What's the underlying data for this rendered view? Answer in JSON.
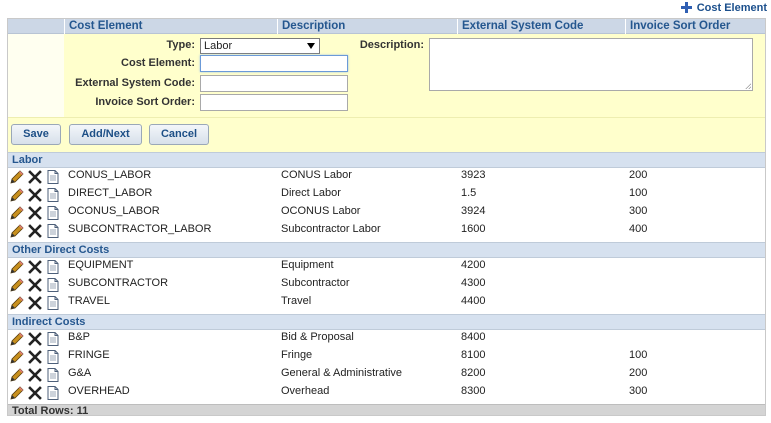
{
  "toolbar": {
    "add_label": "Cost Element",
    "add_icon": "plus-icon"
  },
  "columns": [
    "Cost Element",
    "Description",
    "External System Code",
    "Invoice Sort Order"
  ],
  "form": {
    "type_label": "Type:",
    "type_value": "Labor",
    "cost_element_label": "Cost Element:",
    "cost_element_value": "",
    "external_code_label": "External System Code:",
    "external_code_value": "",
    "sort_order_label": "Invoice Sort Order:",
    "sort_order_value": "",
    "description_label": "Description:",
    "description_value": ""
  },
  "buttons": {
    "save": "Save",
    "add_next": "Add/Next",
    "cancel": "Cancel"
  },
  "groups": [
    {
      "name": "Labor",
      "rows": [
        {
          "element": "CONUS_LABOR",
          "description": "CONUS Labor",
          "code": "3923",
          "sort": "200"
        },
        {
          "element": "DIRECT_LABOR",
          "description": "Direct Labor",
          "code": "1.5",
          "sort": "100"
        },
        {
          "element": "OCONUS_LABOR",
          "description": "OCONUS Labor",
          "code": "3924",
          "sort": "300"
        },
        {
          "element": "SUBCONTRACTOR_LABOR",
          "description": "Subcontractor Labor",
          "code": "1600",
          "sort": "400"
        }
      ]
    },
    {
      "name": "Other Direct Costs",
      "rows": [
        {
          "element": "EQUIPMENT",
          "description": "Equipment",
          "code": "4200",
          "sort": ""
        },
        {
          "element": "SUBCONTRACTOR",
          "description": "Subcontractor",
          "code": "4300",
          "sort": ""
        },
        {
          "element": "TRAVEL",
          "description": "Travel",
          "code": "4400",
          "sort": ""
        }
      ]
    },
    {
      "name": "Indirect Costs",
      "rows": [
        {
          "element": "B&P",
          "description": "Bid & Proposal",
          "code": "8400",
          "sort": ""
        },
        {
          "element": "FRINGE",
          "description": "Fringe",
          "code": "8100",
          "sort": "100"
        },
        {
          "element": "G&A",
          "description": "General & Administrative",
          "code": "8200",
          "sort": "200"
        },
        {
          "element": "OVERHEAD",
          "description": "Overhead",
          "code": "8300",
          "sort": "300"
        }
      ]
    }
  ],
  "footer": {
    "total_rows": "Total Rows: 11"
  },
  "row_icons": [
    "pencil-icon",
    "delete-x-icon",
    "document-icon"
  ],
  "colors": {
    "header_bg": "#ccd7e6",
    "header_text": "#25578f",
    "form_bg": "#ffffcc",
    "section_bg": "#d6e1ef"
  }
}
